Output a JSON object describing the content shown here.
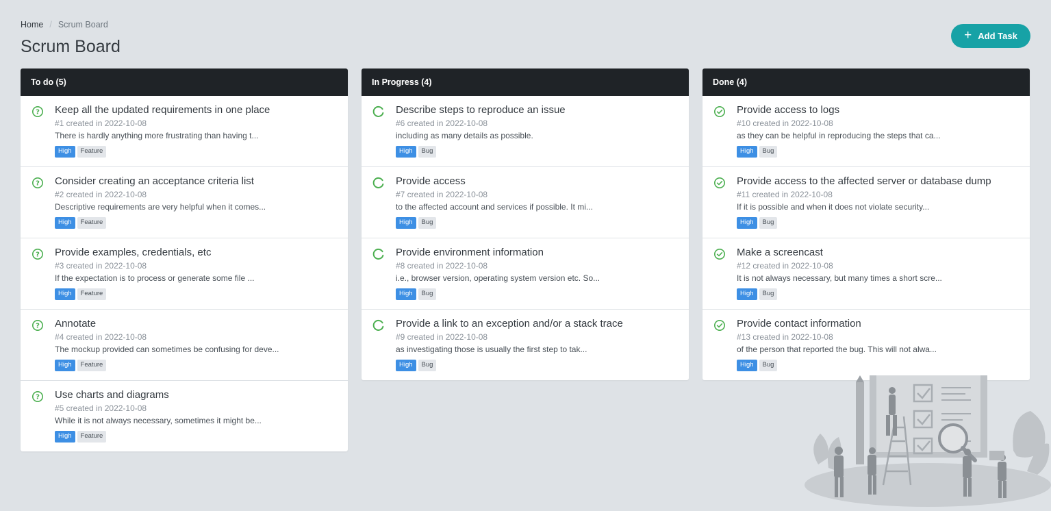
{
  "breadcrumb": {
    "home": "Home",
    "separator": "/",
    "current": "Scrum Board"
  },
  "page_title": "Scrum Board",
  "add_task_label": "Add Task",
  "colors": {
    "accent": "#17a2a6",
    "header_bg": "#1f2327",
    "todo_icon": "#4caf50",
    "high_badge": "#3d8fe4"
  },
  "columns": [
    {
      "title": "To do (5)",
      "icon": "question-circle-icon",
      "cards": [
        {
          "title": "Keep all the updated requirements in one place",
          "meta": "#1 created in 2022-10-08",
          "desc": "There is hardly anything more frustrating than having t...",
          "priority": "High",
          "type": "Feature"
        },
        {
          "title": "Consider creating an acceptance criteria list",
          "meta": "#2 created in 2022-10-08",
          "desc": "Descriptive requirements are very helpful when it comes...",
          "priority": "High",
          "type": "Feature"
        },
        {
          "title": "Provide examples, credentials, etc",
          "meta": "#3 created in 2022-10-08",
          "desc": "If the expectation is to process or generate some file ...",
          "priority": "High",
          "type": "Feature"
        },
        {
          "title": "Annotate",
          "meta": "#4 created in 2022-10-08",
          "desc": "The mockup provided can sometimes be confusing for deve...",
          "priority": "High",
          "type": "Feature"
        },
        {
          "title": "Use charts and diagrams",
          "meta": "#5 created in 2022-10-08",
          "desc": "While it is not always necessary, sometimes it might be...",
          "priority": "High",
          "type": "Feature"
        }
      ]
    },
    {
      "title": "In Progress (4)",
      "icon": "progress-circle-icon",
      "cards": [
        {
          "title": "Describe steps to reproduce an issue",
          "meta": "#6 created in 2022-10-08",
          "desc": "including as many details as possible.",
          "priority": "High",
          "type": "Bug"
        },
        {
          "title": "Provide access",
          "meta": "#7 created in 2022-10-08",
          "desc": "to the affected account and services if possible. It mi...",
          "priority": "High",
          "type": "Bug"
        },
        {
          "title": "Provide environment information",
          "meta": "#8 created in 2022-10-08",
          "desc": "i.e., browser version, operating system version etc. So...",
          "priority": "High",
          "type": "Bug"
        },
        {
          "title": "Provide a link to an exception and/or a stack trace",
          "meta": "#9 created in 2022-10-08",
          "desc": "as investigating those is usually the first step to tak...",
          "priority": "High",
          "type": "Bug"
        }
      ]
    },
    {
      "title": "Done (4)",
      "icon": "check-circle-icon",
      "cards": [
        {
          "title": "Provide access to logs",
          "meta": "#10 created in 2022-10-08",
          "desc": "as they can be helpful in reproducing the steps that ca...",
          "priority": "High",
          "type": "Bug"
        },
        {
          "title": "Provide access to the affected server or database dump",
          "meta": "#11 created in 2022-10-08",
          "desc": "If it is possible and when it does not violate security...",
          "priority": "High",
          "type": "Bug"
        },
        {
          "title": "Make a screencast",
          "meta": "#12 created in 2022-10-08",
          "desc": "It is not always necessary, but many times a short scre...",
          "priority": "High",
          "type": "Bug"
        },
        {
          "title": "Provide contact information",
          "meta": "#13 created in 2022-10-08",
          "desc": "of the person that reported the bug. This will not alwa...",
          "priority": "High",
          "type": "Bug"
        }
      ]
    }
  ]
}
